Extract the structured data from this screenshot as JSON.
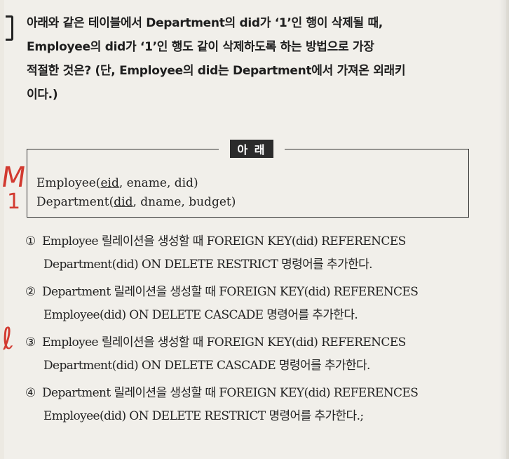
{
  "question": {
    "lines": [
      "아래와 같은 테이블에서 Department의 did가 ‘1’인 행이 삭제될 때,",
      "Employee의 did가 ‘1’인 행도 같이 삭제하도록 하는 방법으로 가장",
      "적절한 것은? (단, Employee의 did는 Department에서 가져온 외래키",
      "이다.)"
    ]
  },
  "box": {
    "title": "아 래",
    "employee": {
      "prefix": "Employee(",
      "key": "eid",
      "rest": ", ename, did)"
    },
    "department": {
      "prefix": "Department(",
      "key": "did",
      "rest": ", dname, budget)"
    }
  },
  "options": [
    {
      "num": "①",
      "line1": "Employee 릴레이션을 생성할 때 FOREIGN KEY(did) REFERENCES",
      "line2": "Department(did) ON DELETE RESTRICT 명령어를 추가한다."
    },
    {
      "num": "②",
      "line1": "Department 릴레이션을 생성할 때 FOREIGN KEY(did) REFERENCES",
      "line2": "Employee(did) ON DELETE CASCADE 명령어를 추가한다."
    },
    {
      "num": "③",
      "line1": "Employee 릴레이션을 생성할 때 FOREIGN KEY(did) REFERENCES",
      "line2": "Department(did) ON DELETE CASCADE 명령어를 추가한다."
    },
    {
      "num": "④",
      "line1": "Department 릴레이션을 생성할 때 FOREIGN KEY(did) REFERENCES",
      "line2": "Employee(did) ON DELETE RESTRICT 명령어를 추가한다.;"
    }
  ],
  "handwriting": {
    "m": "M",
    "one": "1",
    "ell": "ℓ"
  },
  "colors": {
    "handwriting": "#d23a30",
    "paper": "#f1efea"
  }
}
